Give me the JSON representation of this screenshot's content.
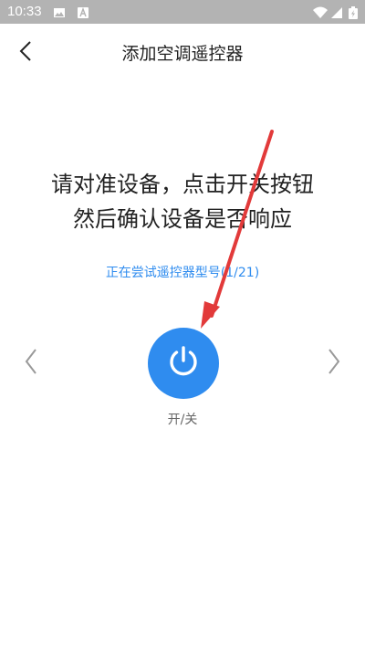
{
  "status_bar": {
    "time": "10:33",
    "icons": [
      "image-icon",
      "a-icon",
      "wifi-icon",
      "signal-icon",
      "battery-icon"
    ]
  },
  "header": {
    "title": "添加空调遥控器",
    "back_icon": "chevron-left-icon"
  },
  "instructions": {
    "line1": "请对准设备，点击开关按钮",
    "line2": "然后确认设备是否响应"
  },
  "trying_model": "正在尝试遥控器型号(1/21)",
  "power": {
    "label": "开/关",
    "icon": "power-icon",
    "color": "#2f8cef"
  },
  "nav": {
    "prev_icon": "chevron-left-icon",
    "next_icon": "chevron-right-icon"
  },
  "colors": {
    "accent": "#2f8cef",
    "annotation_arrow": "#e23a3a",
    "status_bar": "#b3b3b3"
  }
}
